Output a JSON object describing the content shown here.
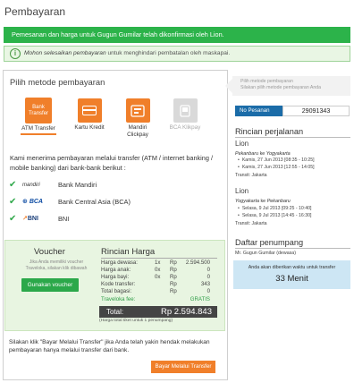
{
  "page": {
    "title": "Pembayaran"
  },
  "alerts": {
    "success": "Pemesanan dan harga untuk Gugun Gumilar telah dikonfirmasi oleh Lion.",
    "info_icon": "info-icon",
    "info_emph": "Mohon selesaikan pembayaran",
    "info_rest": " untuk menghindari pembatalan oleh maskapai."
  },
  "payment": {
    "heading": "Pilih metode pembayaran",
    "methods": [
      {
        "tile": "Bank Transfer",
        "label": "ATM Transfer",
        "selected": true
      },
      {
        "tile": "",
        "icon": "credit-card-icon",
        "label": "Kartu Kredit"
      },
      {
        "tile": "",
        "icon": "clickpay-icon",
        "label": "Mandiri Clickpay"
      },
      {
        "tile": "",
        "icon": "bca-klikpay-icon",
        "label": "BCA Klikpay",
        "disabled": true
      }
    ],
    "description": "Kami menerima pembayaran melalui transfer (ATM / internet banking / mobile banking) dari bank-bank berikut :",
    "banks": [
      {
        "logo": "mandiri",
        "name": "Bank Mandiri"
      },
      {
        "logo": "BCA",
        "name": "Bank Central Asia (BCA)"
      },
      {
        "logo": "BNI",
        "name": "BNI"
      }
    ]
  },
  "voucher": {
    "title": "Voucher",
    "desc": "Jika Anda memiliki voucher Traveloka, silakan klik dibawah",
    "button": "Gunakan voucher"
  },
  "price": {
    "heading": "Rincian Harga",
    "rows": [
      {
        "label": "Harga dewasa:",
        "qty": "1x",
        "cur": "Rp",
        "amount": "2.594.500"
      },
      {
        "label": "Harga anak:",
        "qty": "0x",
        "cur": "Rp",
        "amount": "0"
      },
      {
        "label": "Harga bayi:",
        "qty": "0x",
        "cur": "Rp",
        "amount": "0"
      },
      {
        "label": "Kode transfer:",
        "qty": "",
        "cur": "Rp",
        "amount": "343"
      },
      {
        "label": "Total bagasi:",
        "qty": "",
        "cur": "Rp",
        "amount": "0"
      }
    ],
    "fee": {
      "label": "Traveloka fee:",
      "amount": "GRATIS"
    },
    "total_label": "Total:",
    "total_amount": "Rp 2.594.843",
    "total_note": "(Harga total tiket untuk 1 penumpang)"
  },
  "footer": {
    "text": "Silakan klik \"Bayar Melalui Transfer\" jika Anda telah yakin hendak melakukan pembayaran hanya melalui transfer dari bank.",
    "pay_button": "Bayar Melalui Transfer"
  },
  "sidebar": {
    "step_title": "Pilih metode pembayaran",
    "step_sub": "Silakan pilih metode pembayaran Anda",
    "order_label": "No Pesanan",
    "order_number": "29091343",
    "trip_heading": "Rincian perjalanan",
    "legs": [
      {
        "city": "Lion",
        "route_from": "Pekanbaru",
        "route_to": "Yogyakarta",
        "flights": [
          "Kamis, 27 Jun 2013 [08:35 - 10:25]",
          "Kamis, 27 Jun 2013 [12:55 - 14:05]"
        ],
        "transit": "Transit: Jakarta"
      },
      {
        "city": "Lion",
        "route_from": "Yogyakarta",
        "route_to": "Pekanbaru",
        "flights": [
          "Selasa, 9 Jul 2013 [09:25 - 10:40]",
          "Selasa, 9 Jul 2013 [14:45 - 16:30]"
        ],
        "transit": "Transit: Jakarta"
      }
    ],
    "route_joiner": "ke",
    "passenger_heading": "Daftar penumpang",
    "passenger": "Mr. Gugun Gumilar (dewasa)",
    "timer_label": "Anda akan diberikan waktu untuk transfer",
    "timer_value": "33 Menit"
  },
  "colors": {
    "orange": "#f07f2a",
    "green": "#2cb34a",
    "blue": "#1b6ca8",
    "timer_bg": "#cde6f4"
  }
}
